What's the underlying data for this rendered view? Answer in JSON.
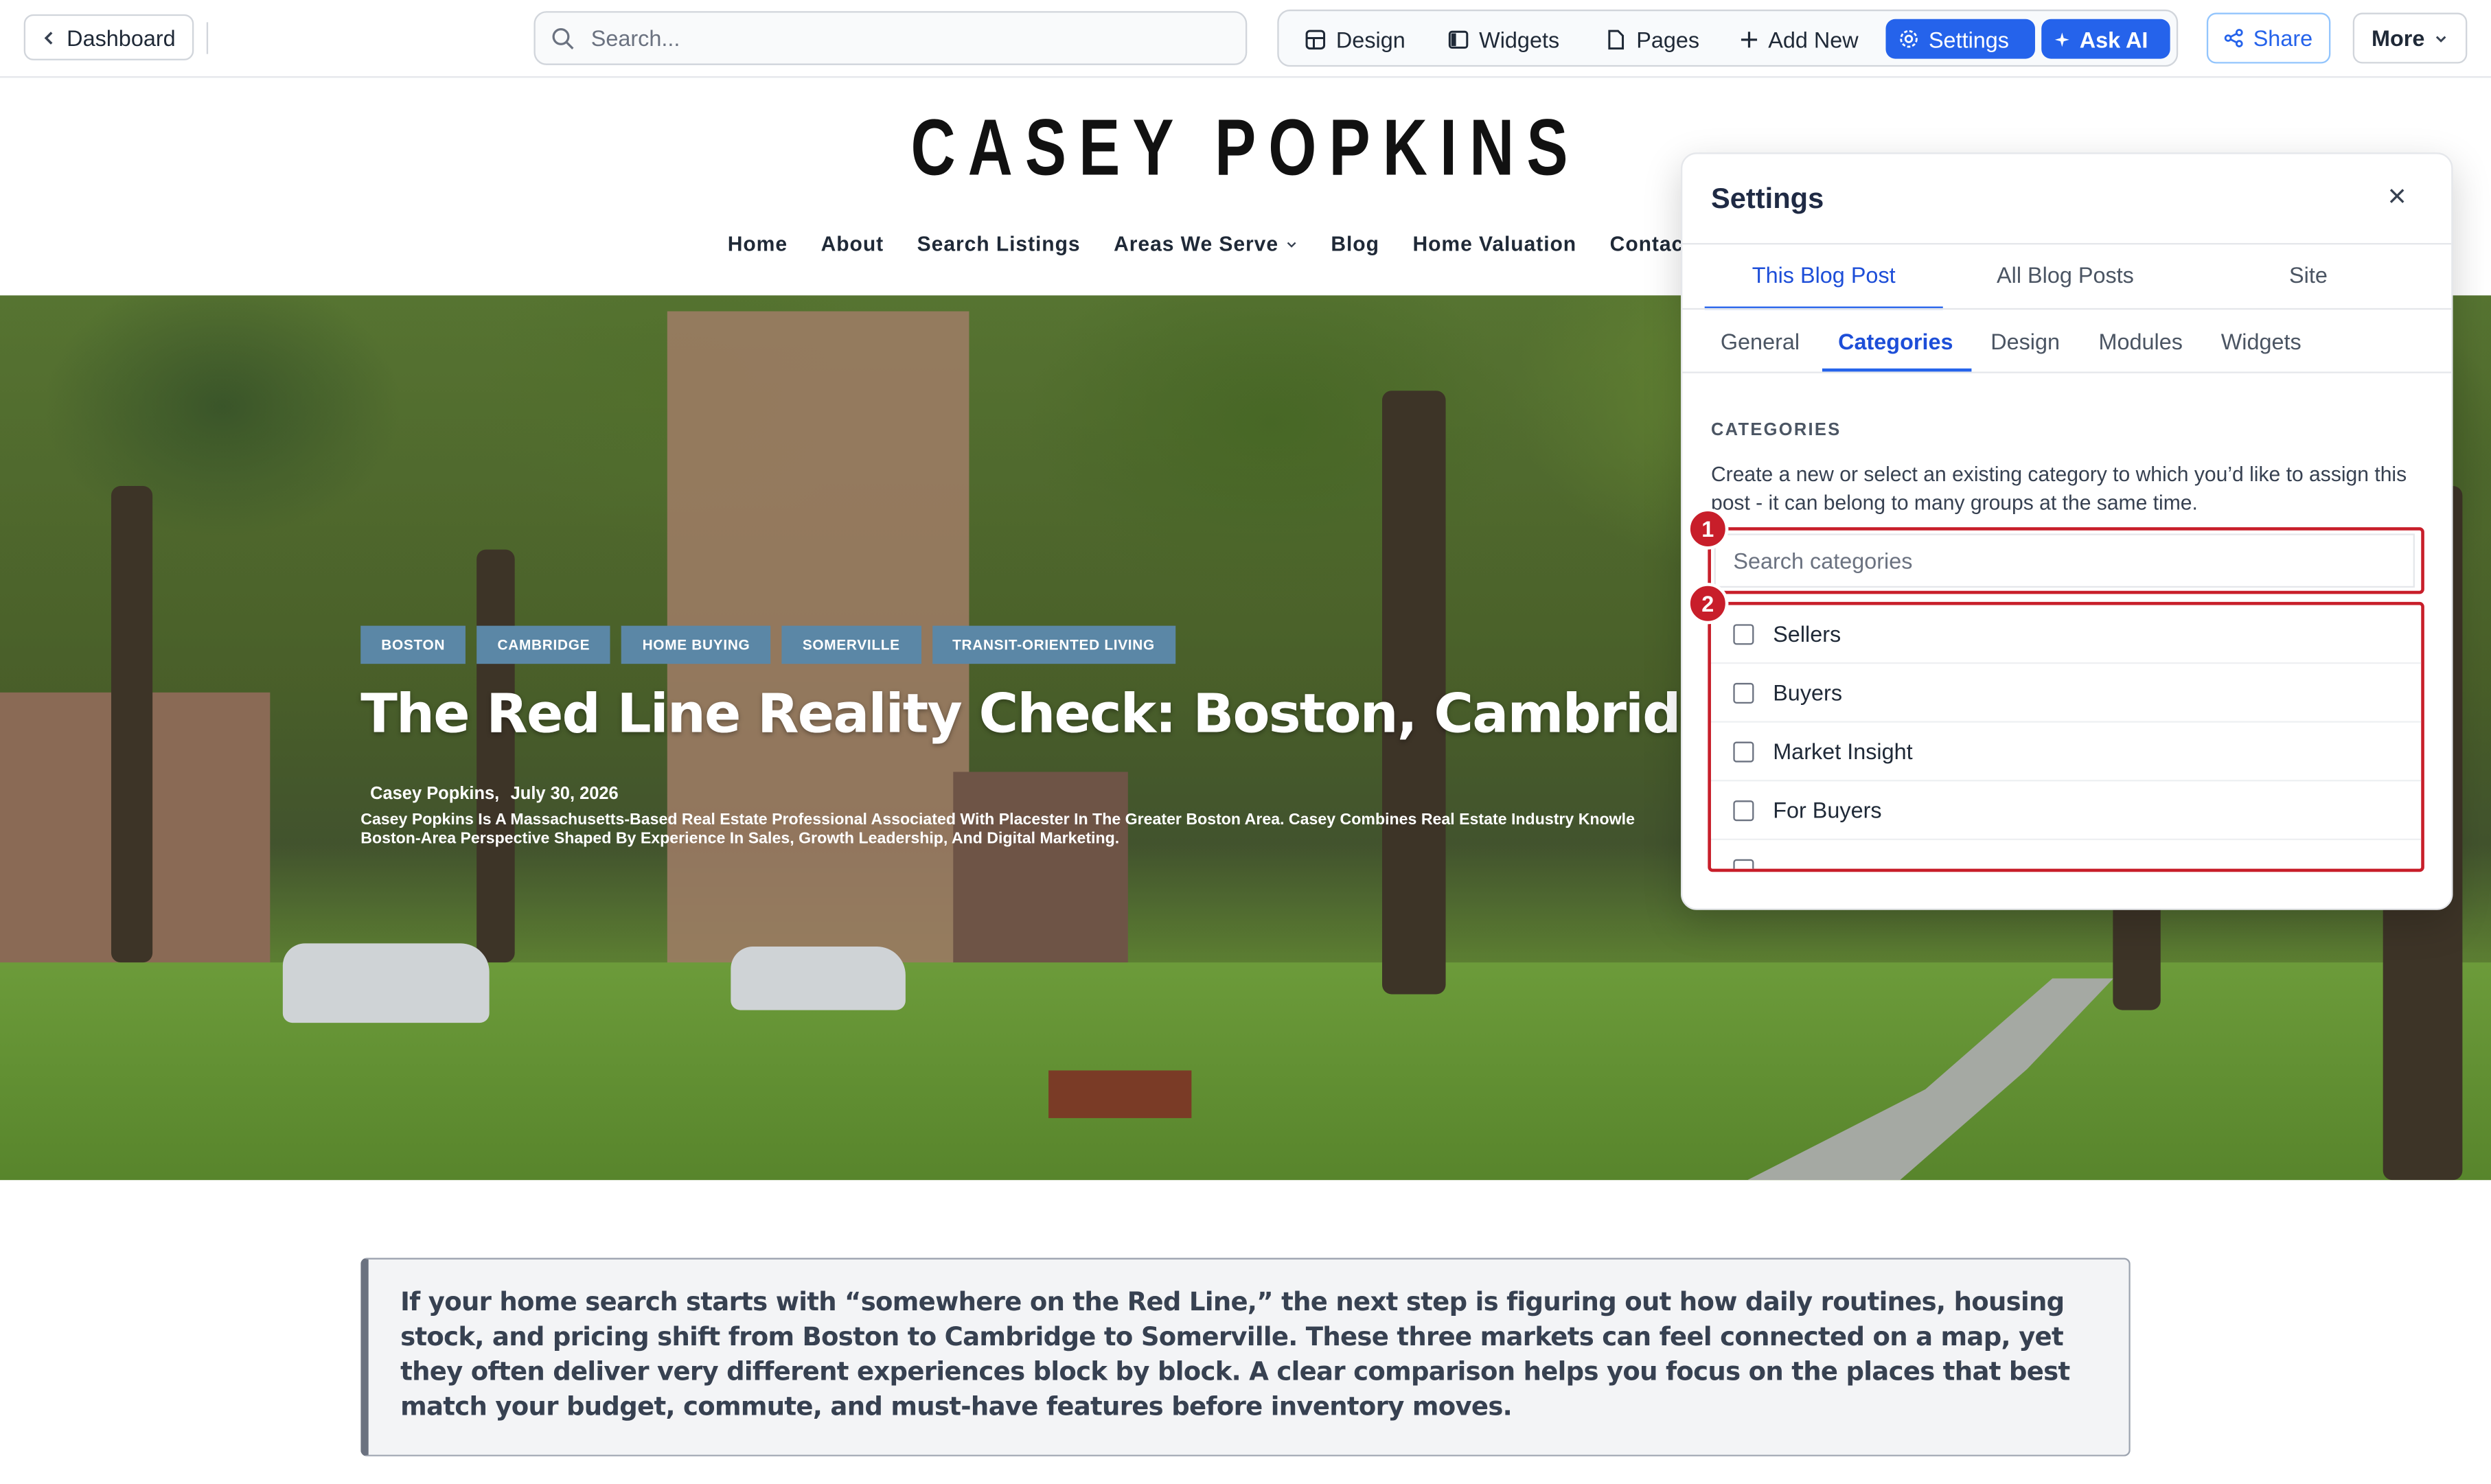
{
  "toolbar": {
    "dashboard_label": "Dashboard",
    "search_placeholder": "Search...",
    "tools": [
      "Design",
      "Widgets",
      "Pages",
      "Add New",
      "Settings",
      "Ask AI"
    ],
    "share_label": "Share",
    "more_label": "More",
    "accent_color": "#2563eb"
  },
  "site": {
    "brand": "CASEY POPKINS",
    "nav": [
      "Home",
      "About",
      "Search Listings",
      "Areas We Serve",
      "Blog",
      "Home Valuation",
      "Contact"
    ]
  },
  "post": {
    "tags": [
      "BOSTON",
      "CAMBRIDGE",
      "HOME BUYING",
      "SOMERVILLE",
      "TRANSIT-ORIENTED LIVING"
    ],
    "title": "The Red Line Reality Check: Boston, Cambridge, and Som",
    "author": "Casey Popkins,",
    "date": "July 30, 2026",
    "bio_line1": "Casey Popkins Is A Massachusetts-Based Real Estate Professional Associated With Placester In The Greater Boston Area. Casey Combines Real Estate Industry Knowle",
    "bio_line2": "Boston-Area Perspective Shaped By Experience In Sales, Growth Leadership, And Digital Marketing.",
    "intro": "If your home search starts with “somewhere on the Red Line,” the next step is figuring out how daily routines, housing stock, and pricing shift from Boston to Cambridge to Somerville. These three markets can feel connected on a map, yet they often deliver very different experiences block by block. A clear comparison helps you focus on the places that best match your budget, commute, and must-have features before inventory moves."
  },
  "settings": {
    "title": "Settings",
    "close_icon": "×",
    "tabs": [
      "This Blog Post",
      "All Blog Posts",
      "Site"
    ],
    "subtabs": [
      "General",
      "Categories",
      "Design",
      "Modules",
      "Widgets"
    ],
    "section_heading": "CATEGORIES",
    "description": "Create a new or select an existing category to which you’d like to assign this post - it can belong to many groups at the same time.",
    "search_placeholder": "Search categories",
    "categories": [
      "Sellers",
      "Buyers",
      "Market Insight",
      "For Buyers"
    ],
    "annotation_1": "1",
    "annotation_2": "2",
    "annotation_color": "#c81e2a"
  }
}
